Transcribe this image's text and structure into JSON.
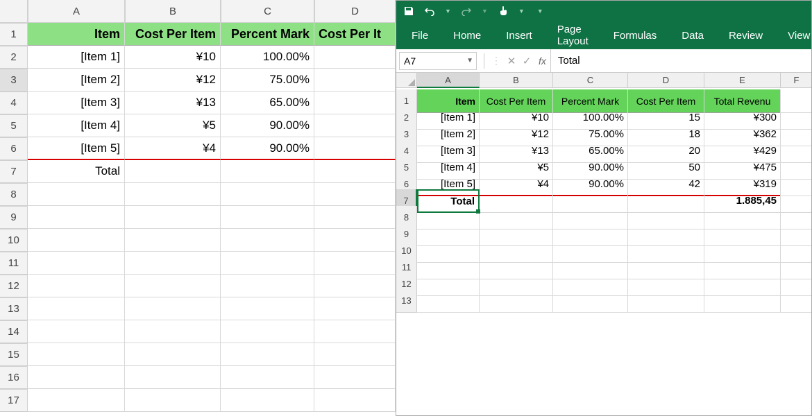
{
  "left": {
    "colHeaders": [
      "A",
      "B",
      "C",
      "D"
    ],
    "rowHeaders": [
      "1",
      "2",
      "3",
      "4",
      "5",
      "6",
      "7",
      "8",
      "9",
      "10",
      "11",
      "12",
      "13",
      "14",
      "15",
      "16",
      "17"
    ],
    "selectedRow": 3,
    "tableHeaders": {
      "A": "Item",
      "B": "Cost Per Item",
      "C": "Percent Mark",
      "D": "Cost Per It"
    },
    "rows": [
      {
        "A": "[Item 1]",
        "B": "¥10",
        "C": "100.00%"
      },
      {
        "A": "[Item 2]",
        "B": "¥12",
        "C": "75.00%"
      },
      {
        "A": "[Item 3]",
        "B": "¥13",
        "C": "65.00%"
      },
      {
        "A": "[Item 4]",
        "B": "¥5",
        "C": "90.00%"
      },
      {
        "A": "[Item 5]",
        "B": "¥4",
        "C": "90.00%"
      }
    ],
    "totalLabel": "Total"
  },
  "right": {
    "qat": {
      "save": "save-icon",
      "undo": "undo-icon",
      "redo": "redo-icon",
      "touch": "touch-icon"
    },
    "tabs": [
      "File",
      "Home",
      "Insert",
      "Page Layout",
      "Formulas",
      "Data",
      "Review",
      "View"
    ],
    "nameBox": "A7",
    "fxLabel": "fx",
    "formula": "Total",
    "colHeaders": [
      "A",
      "B",
      "C",
      "D",
      "E",
      "F"
    ],
    "rowHeaders": [
      "1",
      "2",
      "3",
      "4",
      "5",
      "6",
      "7",
      "8",
      "9",
      "10",
      "11",
      "12",
      "13"
    ],
    "selectedCell": "A7",
    "tableHeaders": {
      "A": "Item",
      "B": "Cost Per Item",
      "C": "Percent Mark",
      "D": "Cost Per Item",
      "E": "Total Revenu"
    },
    "rows": [
      {
        "A": "[Item 1]",
        "B": "¥10",
        "C": "100.00%",
        "D": "15",
        "E": "¥300"
      },
      {
        "A": "[Item 2]",
        "B": "¥12",
        "C": "75.00%",
        "D": "18",
        "E": "¥362"
      },
      {
        "A": "[Item 3]",
        "B": "¥13",
        "C": "65.00%",
        "D": "20",
        "E": "¥429"
      },
      {
        "A": "[Item 4]",
        "B": "¥5",
        "C": "90.00%",
        "D": "50",
        "E": "¥475"
      },
      {
        "A": "[Item 5]",
        "B": "¥4",
        "C": "90.00%",
        "D": "42",
        "E": "¥319"
      }
    ],
    "totalLabel": "Total",
    "totalValue": "1.885,45"
  }
}
